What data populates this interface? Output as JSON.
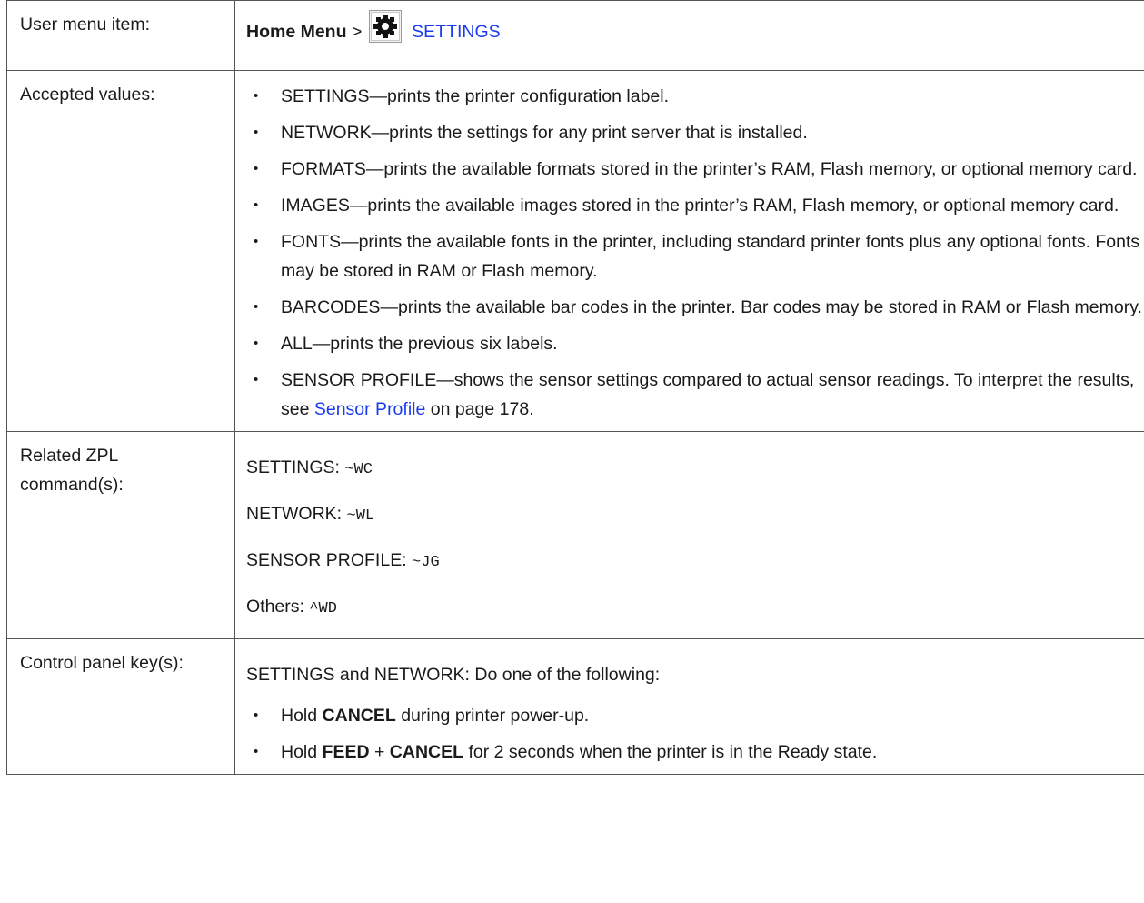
{
  "rows": {
    "user_menu": {
      "label": "User menu item:",
      "home_menu": "Home Menu",
      "separator": ">",
      "icon": "gear-icon",
      "settings_link": "SETTINGS"
    },
    "accepted_values": {
      "label": "Accepted values:",
      "items": [
        "SETTINGS—prints the printer configuration label.",
        "NETWORK—prints the settings for any print server that is installed.",
        "FORMATS—prints the available formats stored in the printer’s RAM, Flash memory, or optional memory card.",
        "IMAGES—prints the available images stored in the printer’s RAM, Flash memory, or optional memory card.",
        "FONTS—prints the available fonts in the printer, including standard printer fonts plus any optional fonts. Fonts may be stored in RAM or Flash memory.",
        "BARCODES—prints the available bar codes in the printer. Bar codes may be stored in RAM or Flash memory.",
        "ALL—prints the previous six labels."
      ],
      "sensor_item": {
        "text": "SENSOR PROFILE—shows the sensor settings compared to actual sensor readings. To interpret the results, see ",
        "link": "Sensor Profile",
        "suffix": " on page 178."
      }
    },
    "zpl": {
      "label": "Related ZPL command(s):",
      "commands": [
        {
          "name": "SETTINGS: ",
          "code": "~WC"
        },
        {
          "name": "NETWORK: ",
          "code": "~WL"
        },
        {
          "name": "SENSOR PROFILE: ",
          "code": "~JG"
        },
        {
          "name": "Others: ",
          "code": "^WD"
        }
      ]
    },
    "control_panel": {
      "label": "Control panel key(s):",
      "intro": "SETTINGS and NETWORK: Do one of the following:",
      "item1": {
        "pre": "Hold ",
        "key": "CANCEL",
        "post": " during printer power-up."
      },
      "item2": {
        "pre": "Hold ",
        "key1": "FEED",
        "plus": " + ",
        "key2": "CANCEL",
        "post": " for 2 seconds when the printer is in the Ready state."
      }
    }
  },
  "colors": {
    "link": "#1a3cf0",
    "border": "#555555",
    "text": "#1a1a1a"
  }
}
